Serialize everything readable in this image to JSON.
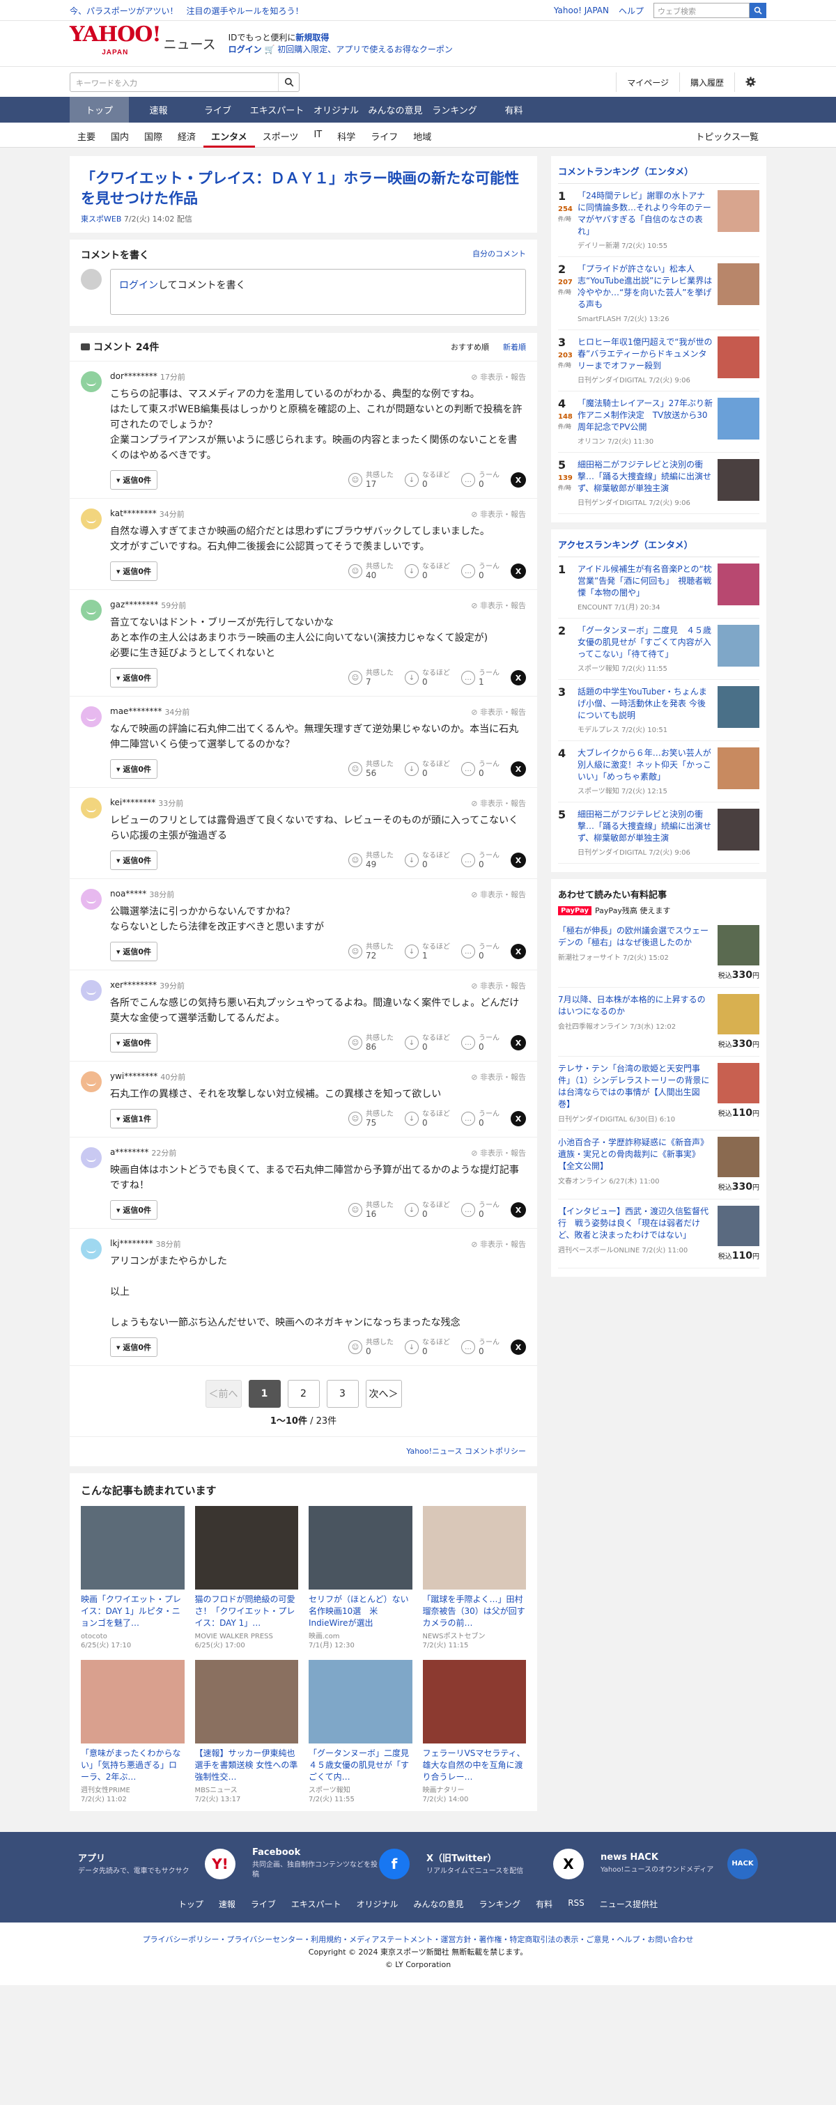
{
  "top": {
    "promo": "今、パラスポーツがアツい！　注目の選手やルールを知ろう！",
    "links": [
      "Yahoo! JAPAN",
      "ヘルプ"
    ],
    "search_placeholder": "ウェブ検索"
  },
  "masthead": {
    "logo": "YAHOO!",
    "logo_sub": "JAPAN",
    "news": "ニュース",
    "id_line1_pre": "IDでもっと便利に",
    "id_line1_link": "新規取得",
    "login": "ログイン",
    "id_line2": "初回購入限定、アプリで使えるお得なクーポン"
  },
  "searchrow": {
    "placeholder": "キーワードを入力",
    "links": [
      "マイページ",
      "購入履歴"
    ]
  },
  "catnav": [
    "トップ",
    "速報",
    "ライブ",
    "エキスパート",
    "オリジナル",
    "みんなの意見",
    "ランキング",
    "有料"
  ],
  "subnav": [
    "主要",
    "国内",
    "国際",
    "経済",
    "エンタメ",
    "スポーツ",
    "IT",
    "科学",
    "ライフ",
    "地域"
  ],
  "subnav_topics": "トピックス一覧",
  "article": {
    "title": "「クワイエット・プレイス：ＤＡＹ１」ホラー映画の新たな可能性を見せつけた作品",
    "source": "東スポWEB",
    "date": "7/2(火) 14:02 配信"
  },
  "write": {
    "heading": "コメントを書く",
    "own": "自分のコメント",
    "login": "ログイン",
    "prompt": "してコメントを書く"
  },
  "comments_head": {
    "title": "コメント 24件",
    "sort": [
      "おすすめ順",
      "新着順"
    ]
  },
  "report_label": "非表示・報告",
  "react_labels": [
    "共感した",
    "なるほど",
    "うーん"
  ],
  "comments": [
    {
      "user": "dor********",
      "time": "17分前",
      "text": "こちらの記事は、マスメディアの力を濫用しているのがわかる、典型的な例ですね。\nはたして東スポWEB編集長はしっかりと原稿を確認の上、これが問題ないとの判断で投稿を許可されたのでしょうか？\n企業コンプライアンスが無いように感じられます。映画の内容とまったく関係のないことを書くのはやめるべきです。",
      "reply": "返信0件",
      "n": [
        "17",
        "0",
        "0"
      ],
      "color": "#8fd19e"
    },
    {
      "user": "kat********",
      "time": "34分前",
      "text": "自然な導入すぎてまさか映画の紹介だとは思わずにブラウザバックしてしまいました。\n文才がすごいですね。石丸伸二後援会に公認貰ってそうで羨ましいです。",
      "reply": "返信0件",
      "n": [
        "40",
        "0",
        "0"
      ],
      "color": "#f2d57e"
    },
    {
      "user": "gaz********",
      "time": "59分前",
      "text": "音立てないはドント・ブリーズが先行してないかな\nあと本作の主人公はあまりホラー映画の主人公に向いてない(演技力じゃなくて設定が)\n必要に生き延びようとしてくれないと",
      "reply": "返信0件",
      "n": [
        "7",
        "0",
        "1"
      ],
      "color": "#8fd19e"
    },
    {
      "user": "mae********",
      "time": "34分前",
      "text": "なんで映画の評論に石丸伸二出てくるんや。無理矢理すぎて逆効果じゃないのか。本当に石丸伸二陣営いくら使って選挙してるのかな？",
      "reply": "返信0件",
      "n": [
        "56",
        "0",
        "0"
      ],
      "color": "#e7b9ef"
    },
    {
      "user": "kei********",
      "time": "33分前",
      "text": "レビューのフリとしては露骨過ぎて良くないですね、レビューそのものが頭に入ってこないくらい応援の主張が強過ぎる",
      "reply": "返信0件",
      "n": [
        "49",
        "0",
        "0"
      ],
      "color": "#f2d57e"
    },
    {
      "user": "noa*****",
      "time": "38分前",
      "text": "公職選挙法に引っかからないんですかね？\nならないとしたら法律を改正すべきと思いますが",
      "reply": "返信0件",
      "n": [
        "72",
        "1",
        "0"
      ],
      "color": "#e7b9ef"
    },
    {
      "user": "xer********",
      "time": "39分前",
      "text": "各所でこんな感じの気持ち悪い石丸プッシュやってるよね。間違いなく案件でしょ。どんだけ莫大な金使って選挙活動してるんだよ。",
      "reply": "返信0件",
      "n": [
        "86",
        "0",
        "0"
      ],
      "color": "#c9c9f2"
    },
    {
      "user": "ywi********",
      "time": "40分前",
      "text": "石丸工作の異様さ、それを攻撃しない対立候補。この異様さを知って欲しい",
      "reply": "返信1件",
      "n": [
        "75",
        "0",
        "0"
      ],
      "color": "#f2b98e"
    },
    {
      "user": "a********",
      "time": "22分前",
      "text": "映画自体はホントどうでも良くて、まるで石丸伸二陣営から予算が出てるかのような提灯記事ですね！",
      "reply": "返信0件",
      "n": [
        "16",
        "0",
        "0"
      ],
      "color": "#c9c9f2"
    },
    {
      "user": "lkj********",
      "time": "38分前",
      "text": "アリコンがまたやらかした\n\n以上\n\nしょうもない一節ぶち込んだせいで、映画へのネガキャンになっちまったな残念",
      "reply": "返信0件",
      "n": [
        "0",
        "0",
        "0"
      ],
      "color": "#9fd8f0"
    }
  ],
  "pager": {
    "prev": "＜前へ",
    "pages": [
      "1",
      "2",
      "3"
    ],
    "next": "次へ＞",
    "info_range": "1〜10件",
    "info_total": " / 23件"
  },
  "policy": "Yahoo!ニュース コメントポリシー",
  "also": {
    "heading": "こんな記事も読まれています",
    "items": [
      {
        "title": "映画「クワイエット・プレイス：DAY 1」ルピタ・ニョンゴを魅了…",
        "src": "otocoto",
        "date": "6/25(火) 17:10",
        "color": "#5c6b78"
      },
      {
        "title": "猫のフロドが問絶級の可愛さ！「クワイエット・プレイス：DAY 1」…",
        "src": "MOVIE WALKER PRESS",
        "date": "6/25(火) 17:00",
        "color": "#3a3530"
      },
      {
        "title": "セリフが（ほとんど）ない名作映画10選　米IndieWireが選出",
        "src": "映画.com",
        "date": "7/1(月) 12:30",
        "color": "#4a5560"
      },
      {
        "title": "「蹴球を手際よく…」田村瑠奈被告（30）は父が回すカメラの前…",
        "src": "NEWSポストセブン",
        "date": "7/2(火) 11:15",
        "color": "#d9c7b8"
      },
      {
        "title": "「意味がまったくわからない」「気持ち悪過ぎる」ローラ、2年ぶ…",
        "src": "週刊女性PRIME",
        "date": "7/2(火) 11:02",
        "color": "#d9a08e"
      },
      {
        "title": "【速報】サッカー伊東純也選手を書類送検 女性への準強制性交…",
        "src": "MBSニュース",
        "date": "7/2(火) 13:17",
        "color": "#8a7060"
      },
      {
        "title": "「グータンヌーボ」二度見　４５歳女優の肌見せが「すごくて内…",
        "src": "スポーツ報知",
        "date": "7/2(火) 11:55",
        "color": "#7fa7c8"
      },
      {
        "title": "フェラーリVSマセラティ、雄大な自然の中を互角に渡り合うレー…",
        "src": "映画ナタリー",
        "date": "7/2(火) 14:00",
        "color": "#8c3a30"
      }
    ]
  },
  "comment_ranking": {
    "heading": "コメントランキング（エンタメ）",
    "count_unit": "件/時",
    "items": [
      {
        "rank": "1",
        "count": "254",
        "title": "「24時間テレビ」謝罪の水卜アナに同情論多数…それより今年のテーマがヤバすぎる「自信のなさの表れ」",
        "src": "デイリー新潮 7/2(火) 10:55",
        "color": "#d8a58e"
      },
      {
        "rank": "2",
        "count": "207",
        "title": "「プライドが許さない」松本人志“YouTube進出説”にテレビ業界は冷ややか…“芽を向いた芸人”を挙げる声も",
        "src": "SmartFLASH 7/2(火) 13:26",
        "color": "#b8866a"
      },
      {
        "rank": "3",
        "count": "203",
        "title": "ヒロヒー年収1億円超えで“我が世の春”バラエティーからドキュメンタリーまでオファー殺到",
        "src": "日刊ゲンダイDIGITAL 7/2(火) 9:06",
        "color": "#c65a4e"
      },
      {
        "rank": "4",
        "count": "148",
        "title": "「魔法騎士レイアース」27年ぶり新作アニメ制作決定　TV放送から30周年記念でPV公開",
        "src": "オリコン 7/2(火) 11:30",
        "color": "#6aa0d8"
      },
      {
        "rank": "5",
        "count": "139",
        "title": "細田裕二がフジテレビと決別の衝撃…「踊る大捜査線」続編に出演せず、柳葉敏郎が単独主演",
        "src": "日刊ゲンダイDIGITAL 7/2(火) 9:06",
        "color": "#4a4040"
      }
    ]
  },
  "access_ranking": {
    "heading": "アクセスランキング（エンタメ）",
    "items": [
      {
        "rank": "1",
        "title": "アイドル候補生が有名音楽Pとの“枕営業”告発「酒に何回も」　視聴者戦慄「本物の闇や」",
        "src": "ENCOUNT 7/1(月) 20:34",
        "color": "#b84870"
      },
      {
        "rank": "2",
        "title": "「グータンヌーボ」二度見　４５歳女優の肌見せが「すごくて内容が入ってこない」「待て待て」",
        "src": "スポーツ報知 7/2(火) 11:55",
        "color": "#7fa7c8"
      },
      {
        "rank": "3",
        "title": "話題の中学生YouTuber・ちょんまげ小僧、一時活動休止を発表 今後についても説明",
        "src": "モデルプレス 7/2(火) 10:51",
        "color": "#4a7088"
      },
      {
        "rank": "4",
        "title": "大ブレイクから６年…お笑い芸人が別人級に激変！ネット仰天「かっこいい」「めっちゃ素敵」",
        "src": "スポーツ報知 7/2(火) 12:15",
        "color": "#c88a60"
      },
      {
        "rank": "5",
        "title": "細田裕二がフジテレビと決別の衝撃…「踊る大捜査線」続編に出演せず、柳葉敏郎が単独主演",
        "src": "日刊ゲンダイDIGITAL 7/2(火) 9:06",
        "color": "#4a4040"
      }
    ]
  },
  "paid": {
    "heading": "あわせて読みたい有料記事",
    "pay_logo": "PayPay",
    "pay_text": "PayPay残高 使えます",
    "price_pre": "税込",
    "items": [
      {
        "title": "「極右が伸長」の欧州議会選でスウェーデンの「極右」はなぜ後退したのか",
        "src": "新潮社フォーサイト 7/2(火) 15:02",
        "price": "330",
        "unit": "円",
        "color": "#5a6a50"
      },
      {
        "title": "7月以降、日本株が本格的に上昇するのはいつになるのか",
        "src": "会社四季報オンライン 7/3(水) 12:02",
        "price": "330",
        "unit": "円",
        "color": "#d8b050"
      },
      {
        "title": "テレサ・テン「台湾の歌姫と天安門事件」（1）シンデレラストーリーの背景には台湾ならではの事情が【人間出生図巻】",
        "src": "日刊ゲンダイDIGITAL 6/30(日) 6:10",
        "price": "110",
        "unit": "円",
        "color": "#c86050"
      },
      {
        "title": "小池百合子・学歴詐称疑惑に《新音声》遺族・実兄との骨肉裁判に《新事実》【全文公開】",
        "src": "文春オンライン 6/27(木) 11:00",
        "price": "330",
        "unit": "円",
        "color": "#8a6a50"
      },
      {
        "title": "【インタビュー】西武・渡辺久信監督代行　戦う姿勢は良く「現在は弱者だけど、敗者と決まったわけではない」",
        "src": "週刊ベースボールONLINE 7/2(火) 11:00",
        "price": "110",
        "unit": "円",
        "color": "#5a6a80"
      }
    ]
  },
  "apps": [
    {
      "title": "アプリ",
      "desc": "データ先読みで、電車でもサクサク",
      "icon": "Y!",
      "bg": "#fff",
      "fg": "#d1001f"
    },
    {
      "title": "Facebook",
      "desc": "共同企画、独自制作コンテンツなどを投稿",
      "icon": "f",
      "bg": "#1877f2",
      "fg": "#fff"
    },
    {
      "title": "X（旧Twitter）",
      "desc": "リアルタイムでニュースを配信",
      "icon": "X",
      "bg": "#fff",
      "fg": "#000"
    },
    {
      "title": "news HACK",
      "desc": "Yahoo!ニュースのオウンドメディア",
      "icon": "HACK",
      "bg": "#2a6cc8",
      "fg": "#fff"
    }
  ],
  "footer_nav": [
    "トップ",
    "速報",
    "ライブ",
    "エキスパート",
    "オリジナル",
    "みんなの意見",
    "ランキング",
    "有料",
    "RSS",
    "ニュース提供社"
  ],
  "legal": {
    "links": "プライバシーポリシー・プライバシーセンター・利用規約・メディアステートメント・運営方針・著作権・特定商取引法の表示・ご意見・ヘルプ・お問い合わせ",
    "copy1": "Copyright © 2024 東京スポーツ新聞社 無断転載を禁じます。",
    "copy2": "© LY Corporation"
  }
}
